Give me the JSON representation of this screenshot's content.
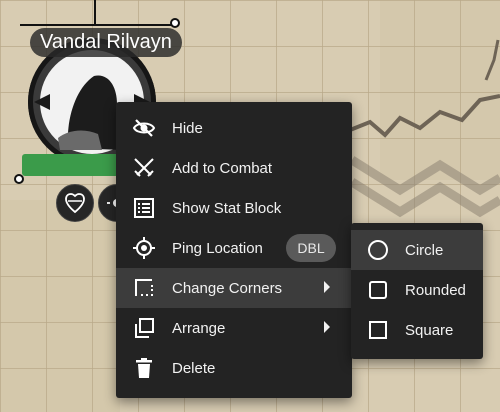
{
  "token": {
    "name": "Vandal Rilvayn",
    "hp_color": "#3b9b4a",
    "buttons": [
      {
        "icon": "heart-shield-icon"
      },
      {
        "icon": "sun-icon"
      }
    ]
  },
  "context_menu": {
    "items": [
      {
        "id": "hide",
        "label": "Hide",
        "icon": "eye-off-icon"
      },
      {
        "id": "add-to-combat",
        "label": "Add to Combat",
        "icon": "crossed-swords-icon"
      },
      {
        "id": "show-stat-block",
        "label": "Show Stat Block",
        "icon": "list-icon"
      },
      {
        "id": "ping-location",
        "label": "Ping Location",
        "icon": "target-icon",
        "badge": "DBL"
      },
      {
        "id": "change-corners",
        "label": "Change Corners",
        "icon": "dashed-corner-icon",
        "submenu": true,
        "active": true
      },
      {
        "id": "arrange",
        "label": "Arrange",
        "icon": "layers-icon",
        "submenu": true
      },
      {
        "id": "delete",
        "label": "Delete",
        "icon": "trash-icon"
      }
    ]
  },
  "corners_submenu": {
    "items": [
      {
        "id": "circle",
        "label": "Circle",
        "icon": "circle-outline-icon",
        "active": true
      },
      {
        "id": "rounded",
        "label": "Rounded",
        "icon": "rounded-square-icon"
      },
      {
        "id": "square",
        "label": "Square",
        "icon": "square-icon"
      }
    ]
  },
  "colors": {
    "menu_bg": "#232323",
    "menu_active": "#3c3c3c",
    "map_bg": "#d9cdb4"
  }
}
